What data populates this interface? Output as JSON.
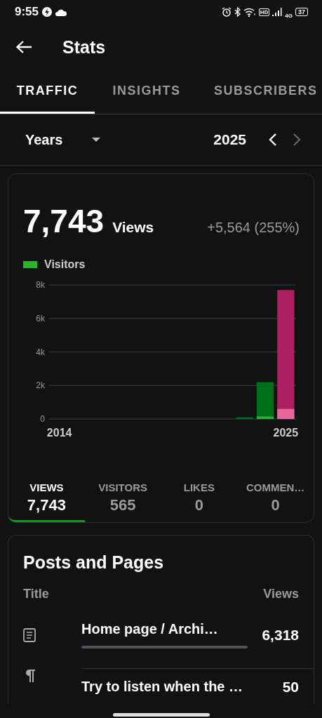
{
  "status_bar": {
    "time": "9:55",
    "hd": "HD",
    "network": "4G",
    "battery": "37"
  },
  "app_bar": {
    "title": "Stats"
  },
  "tabs": [
    {
      "label": "TRAFFIC",
      "selected": true
    },
    {
      "label": "INSIGHTS",
      "selected": false
    },
    {
      "label": "SUBSCRIBERS",
      "selected": false
    }
  ],
  "period": {
    "unit": "Years",
    "value": "2025",
    "next_disabled": true
  },
  "summary": {
    "total": "7,743",
    "unit": "Views",
    "change": "+5,564 (255%)",
    "chart_data": {
      "type": "bar",
      "x": [
        2014,
        2015,
        2016,
        2017,
        2018,
        2019,
        2020,
        2021,
        2022,
        2023,
        2024,
        2025
      ],
      "xticks": [
        2014,
        2025
      ],
      "xlim": [
        2013.5,
        2025.5
      ],
      "yticks": [
        {
          "value": 0,
          "label": "0"
        },
        {
          "value": 2000,
          "label": "2k"
        },
        {
          "value": 4000,
          "label": "4k"
        },
        {
          "value": 6000,
          "label": "6k"
        },
        {
          "value": 8000,
          "label": "8k"
        }
      ],
      "ylim": [
        0,
        8000
      ],
      "stacked": false,
      "grid": true,
      "series": [
        {
          "color": "#006f1a",
          "values": [
            0,
            0,
            0,
            0,
            0,
            0,
            0,
            0,
            0,
            100,
            2200,
            null
          ]
        },
        {
          "name": "Visitors",
          "color": "#2bb32b",
          "values": [
            0,
            0,
            0,
            0,
            0,
            0,
            0,
            0,
            0,
            null,
            150,
            null
          ]
        },
        {
          "color": "#ad2060",
          "values": [
            null,
            null,
            null,
            null,
            null,
            null,
            null,
            null,
            null,
            null,
            null,
            7700
          ]
        },
        {
          "color": "#e8679a",
          "values": [
            null,
            null,
            null,
            null,
            null,
            null,
            null,
            null,
            null,
            null,
            null,
            600
          ]
        }
      ]
    }
  },
  "metrics": [
    {
      "label": "VIEWS",
      "value": "7,743",
      "selected": true
    },
    {
      "label": "VISITORS",
      "value": "565",
      "selected": false
    },
    {
      "label": "LIKES",
      "value": "0",
      "selected": false
    },
    {
      "label": "COMMEN…",
      "value": "0",
      "selected": false
    }
  ],
  "posts": {
    "title": "Posts and Pages",
    "columns": [
      "Title",
      "Views"
    ],
    "rows": [
      {
        "kind": "page",
        "title": "Home page / Archi…",
        "views": "6,318",
        "bar": true
      },
      {
        "kind": "post",
        "title": "Try to listen when the …",
        "views": "50"
      }
    ]
  }
}
